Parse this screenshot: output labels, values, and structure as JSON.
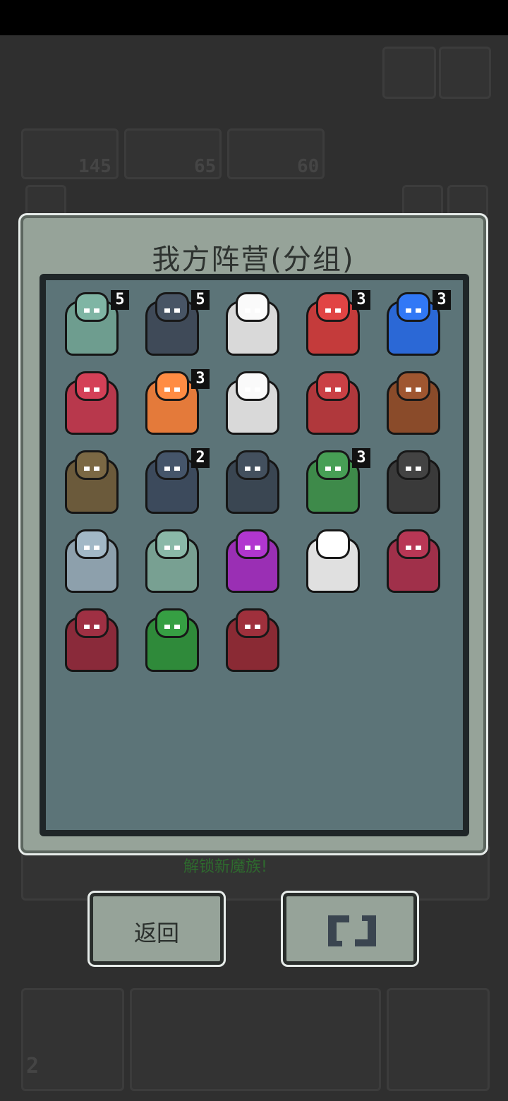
{
  "panel": {
    "title": "我方阵营(分组)"
  },
  "buttons": {
    "back_label": "返回",
    "swap_icon": "swap-icon"
  },
  "background": {
    "counts": [
      "145",
      "65",
      "60"
    ],
    "bottom_count": "2",
    "green_text": "解锁新魔族!"
  },
  "units": [
    {
      "name": "green-lizardman",
      "badge": "5",
      "color": "#6e9d8f"
    },
    {
      "name": "dark-whale",
      "badge": "5",
      "color": "#3f4a58"
    },
    {
      "name": "blonde-knight",
      "badge": "",
      "color": "#d9d9d9"
    },
    {
      "name": "red-hood-girl",
      "badge": "3",
      "color": "#c43b3b"
    },
    {
      "name": "blue-cube-golem",
      "badge": "3",
      "color": "#2b68d6"
    },
    {
      "name": "red-horned-demon",
      "badge": "",
      "color": "#b8384c"
    },
    {
      "name": "orange-fish-mage",
      "badge": "3",
      "color": "#e47a3a"
    },
    {
      "name": "white-haired-vampire",
      "badge": "",
      "color": "#d9d9d9"
    },
    {
      "name": "skull-warlord",
      "badge": "",
      "color": "#b0383c"
    },
    {
      "name": "lava-rock-golem",
      "badge": "",
      "color": "#8a4b2a"
    },
    {
      "name": "rock-beast",
      "badge": "",
      "color": "#6b5a3b"
    },
    {
      "name": "shadow-gargoyle",
      "badge": "2",
      "color": "#3c4a5c"
    },
    {
      "name": "spiked-tentacle-beast",
      "badge": "",
      "color": "#3a4652"
    },
    {
      "name": "green-minotaur",
      "badge": "3",
      "color": "#3e8a4a"
    },
    {
      "name": "mimic-chest",
      "badge": "",
      "color": "#3a3a3a"
    },
    {
      "name": "gray-stone-giant",
      "badge": "",
      "color": "#8da0ac"
    },
    {
      "name": "pale-lizard",
      "badge": "",
      "color": "#78a092"
    },
    {
      "name": "purple-dragon",
      "badge": "",
      "color": "#9a2fb4"
    },
    {
      "name": "white-ape",
      "badge": "",
      "color": "#e0e0e0"
    },
    {
      "name": "crimson-bat",
      "badge": "",
      "color": "#a0304a"
    },
    {
      "name": "red-hooded-wizard",
      "badge": "",
      "color": "#8a2a3a"
    },
    {
      "name": "green-dark-beast",
      "badge": "",
      "color": "#2f8a3a"
    },
    {
      "name": "red-triple-demon",
      "badge": "",
      "color": "#8a2a34"
    }
  ]
}
